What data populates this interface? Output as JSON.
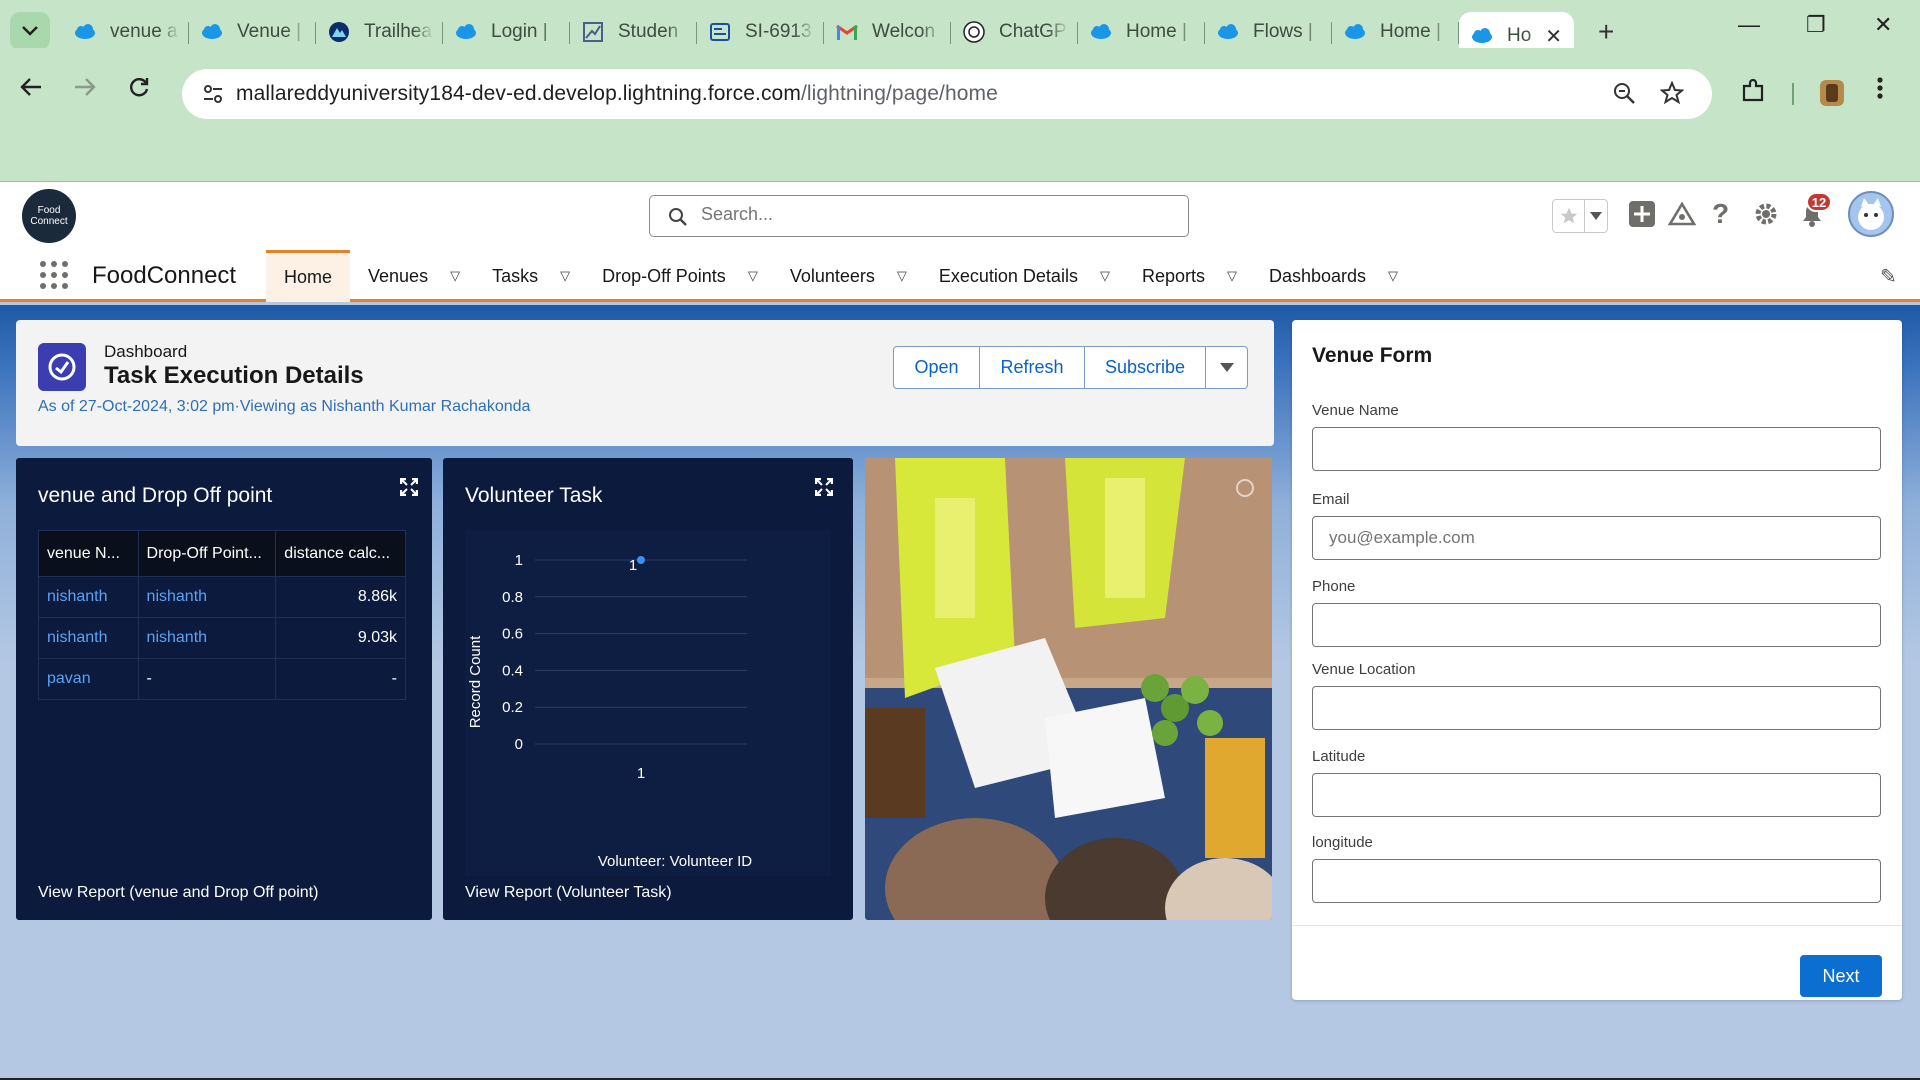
{
  "browser": {
    "tabs": [
      {
        "title": "venue a",
        "favicon": "salesforce-cloud-icon"
      },
      {
        "title": "Venue |",
        "favicon": "salesforce-cloud-icon"
      },
      {
        "title": "Trailhea",
        "favicon": "trailhead-icon"
      },
      {
        "title": "Login |",
        "favicon": "salesforce-cloud-icon"
      },
      {
        "title": "Studen",
        "favicon": "chart-icon"
      },
      {
        "title": "SI-6913",
        "favicon": "form-icon"
      },
      {
        "title": "Welcon",
        "favicon": "gmail-icon"
      },
      {
        "title": "ChatGP",
        "favicon": "chatgpt-icon"
      },
      {
        "title": "Home |",
        "favicon": "salesforce-cloud-icon"
      },
      {
        "title": "Flows |",
        "favicon": "salesforce-cloud-icon"
      },
      {
        "title": "Home |",
        "favicon": "salesforce-cloud-icon"
      },
      {
        "title": "Ho",
        "favicon": "salesforce-cloud-icon"
      }
    ],
    "url_host": "mallareddyuniversity184-dev-ed.develop.lightning.force.com",
    "url_path": "/lightning/page/home"
  },
  "header": {
    "logo_text": "Food Connect",
    "search_placeholder": "Search...",
    "notifications_count": "12"
  },
  "nav": {
    "app_name": "FoodConnect",
    "items": [
      {
        "label": "Home",
        "active": true
      },
      {
        "label": "Venues"
      },
      {
        "label": "Tasks"
      },
      {
        "label": "Drop-Off Points"
      },
      {
        "label": "Volunteers"
      },
      {
        "label": "Execution Details"
      },
      {
        "label": "Reports"
      },
      {
        "label": "Dashboards"
      }
    ]
  },
  "dashboard": {
    "eyebrow": "Dashboard",
    "title": "Task Execution Details",
    "subtitle": "As of 27-Oct-2024, 3:02 pm·Viewing as Nishanth Kumar Rachakonda",
    "buttons": {
      "open": "Open",
      "refresh": "Refresh",
      "subscribe": "Subscribe"
    }
  },
  "venue_table": {
    "title": "venue and Drop Off point",
    "columns": [
      "venue N...",
      "Drop-Off Point...",
      "distance calc..."
    ],
    "rows": [
      [
        "nishanth",
        "nishanth",
        "8.86k"
      ],
      [
        "nishanth",
        "nishanth",
        "9.03k"
      ],
      [
        "pavan",
        "-",
        "-"
      ]
    ],
    "footer": "View Report (venue and Drop Off point)"
  },
  "volunteer_chart": {
    "title": "Volunteer Task",
    "footer": "View Report (Volunteer Task)"
  },
  "chart_data": {
    "type": "scatter",
    "x": [
      "1"
    ],
    "values": [
      1
    ],
    "data_labels": [
      "1"
    ],
    "xlabel": "Volunteer: Volunteer ID",
    "ylabel": "Record Count",
    "yticks": [
      "1",
      "0.8",
      "0.6",
      "0.4",
      "0.2",
      "0"
    ],
    "ylim": [
      0,
      1
    ],
    "color": "#3b8ff0"
  },
  "venue_form": {
    "title": "Venue Form",
    "fields": [
      {
        "label": "Venue Name",
        "placeholder": "",
        "value": ""
      },
      {
        "label": "Email",
        "placeholder": "you@example.com",
        "value": ""
      },
      {
        "label": "Phone",
        "placeholder": "",
        "value": ""
      },
      {
        "label": "Venue Location",
        "placeholder": "",
        "value": ""
      },
      {
        "label": "Latitude",
        "placeholder": "",
        "value": ""
      },
      {
        "label": "longitude",
        "placeholder": "",
        "value": ""
      }
    ],
    "next_label": "Next"
  },
  "colors": {
    "browser_chrome": "#c6e4c8",
    "nav_accent": "#e2822a",
    "card_bg": "#0b1a3d",
    "brand_button": "#0b6ed1",
    "link": "#0b62c4"
  }
}
